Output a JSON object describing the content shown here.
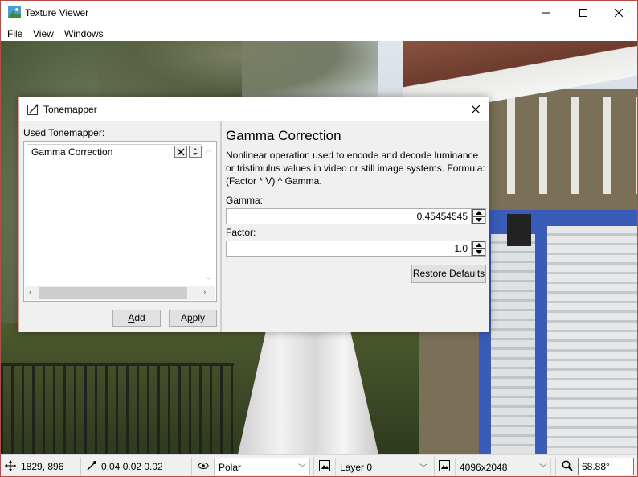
{
  "window": {
    "title": "Texture Viewer",
    "icon": "landscape-image-icon"
  },
  "menu": [
    "File",
    "View",
    "Windows"
  ],
  "dialog": {
    "title": "Tonemapper",
    "used_label": "Used Tonemapper:",
    "entries": [
      {
        "label": "Gamma Correction"
      }
    ],
    "add_prefix": "",
    "add_underline": "A",
    "add_rest": "dd",
    "apply_prefix": "A",
    "apply_underline": "p",
    "apply_rest": "ply",
    "tonemapper": {
      "name": "Gamma Correction",
      "description": "Nonlinear operation used to encode and decode luminance or tristimulus values in video or still image systems. Formula: (Factor * V) ^ Gamma.",
      "params": [
        {
          "label": "Gamma:",
          "value": "0.45454545"
        },
        {
          "label": "Factor:",
          "value": "1.0"
        }
      ],
      "restore_label": "Restore Defaults"
    }
  },
  "status": {
    "cursor": "1829, 896",
    "color": "0.04 0.02 0.02",
    "projection": "Polar",
    "layer": "Layer 0",
    "resolution": "4096x2048",
    "zoom": "68.88°"
  },
  "colors": {
    "accent_border": "#e29a95",
    "window_border": "#b94a48",
    "door_blue": "#3a5bb7"
  }
}
